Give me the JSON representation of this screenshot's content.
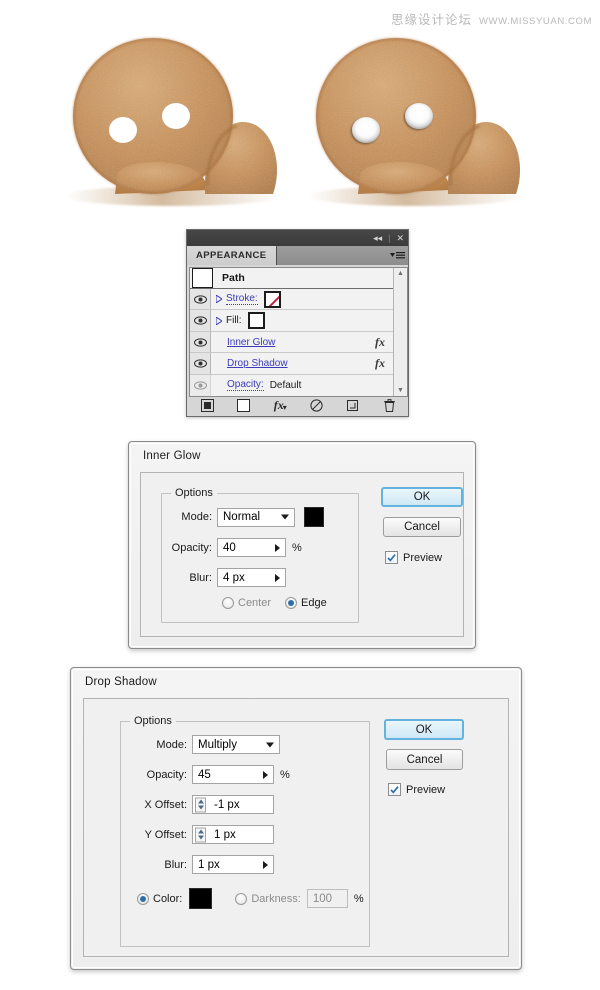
{
  "watermark": {
    "cn": "思缘设计论坛",
    "en": "WWW.MISSYUAN.COM"
  },
  "figures": [
    {
      "name": "gingerbread-before",
      "label": "gingerbread head with flat hollow eyes",
      "body_color": "#c18a52",
      "body_color_light": "#d9a873",
      "eye_fill": "#ffffff",
      "eye_style": "flat"
    },
    {
      "name": "gingerbread-after",
      "label": "gingerbread head with inner-glow and drop-shadow eyes",
      "body_color": "#c18a52",
      "body_color_light": "#d9a873",
      "eye_fill": "#ffffff",
      "eye_style": "glow"
    }
  ],
  "appearance_panel": {
    "tab_label": "APPEARANCE",
    "collapse_icon": "double-chevron-left-icon",
    "close_icon": "close-icon",
    "menu_icon": "panel-menu-icon",
    "path_row": {
      "name": "Path",
      "thumb": "white-swatch"
    },
    "rows": [
      {
        "label": "Stroke:",
        "underline": "dotted",
        "has_disclosure": true,
        "swatch": "none",
        "fx": "",
        "value": "",
        "eye": "visible"
      },
      {
        "label": "Fill:",
        "underline": "none",
        "has_disclosure": true,
        "swatch": "white",
        "fx": "",
        "value": "",
        "eye": "visible"
      },
      {
        "label": "Inner Glow",
        "underline": "solid",
        "has_disclosure": false,
        "swatch": "",
        "fx": "fx",
        "value": "",
        "eye": "visible"
      },
      {
        "label": "Drop Shadow",
        "underline": "solid",
        "has_disclosure": false,
        "swatch": "",
        "fx": "fx",
        "value": "",
        "eye": "visible"
      },
      {
        "label": "Opacity:",
        "underline": "dotted",
        "has_disclosure": false,
        "swatch": "",
        "fx": "",
        "value": "Default",
        "eye": "dim"
      }
    ],
    "scroll_up_icon": "scroll-up-arrow-icon",
    "scroll_down_icon": "scroll-down-arrow-icon",
    "footer_buttons": [
      {
        "name": "add-new-stroke-button",
        "icon": "filled-square-icon"
      },
      {
        "name": "add-new-fill-button",
        "icon": "empty-square-icon"
      },
      {
        "name": "add-new-effect-button",
        "icon": "fx-icon"
      },
      {
        "name": "clear-appearance-button",
        "icon": "no-entry-icon"
      },
      {
        "name": "duplicate-item-button",
        "icon": "duplicate-icon"
      },
      {
        "name": "delete-item-button",
        "icon": "trash-icon"
      }
    ]
  },
  "inner_glow_dialog": {
    "title": "Inner Glow",
    "options_legend": "Options",
    "mode_label": "Mode:",
    "mode_value": "Normal",
    "color_swatch": "#000000",
    "opacity_label": "Opacity:",
    "opacity_value": "40",
    "opacity_unit": "%",
    "blur_label": "Blur:",
    "blur_value": "4 px",
    "center_label": "Center",
    "edge_label": "Edge",
    "selected_origin": "Edge",
    "ok_label": "OK",
    "cancel_label": "Cancel",
    "preview_label": "Preview",
    "preview_checked": true
  },
  "drop_shadow_dialog": {
    "title": "Drop Shadow",
    "options_legend": "Options",
    "mode_label": "Mode:",
    "mode_value": "Multiply",
    "opacity_label": "Opacity:",
    "opacity_value": "45",
    "opacity_unit": "%",
    "x_offset_label": "X Offset:",
    "x_offset_value": "-1 px",
    "y_offset_label": "Y Offset:",
    "y_offset_value": "1 px",
    "blur_label": "Blur:",
    "blur_value": "1 px",
    "color_label": "Color:",
    "color_swatch": "#000000",
    "darkness_label": "Darkness:",
    "darkness_value": "100",
    "darkness_unit": "%",
    "selected_tint": "Color",
    "ok_label": "OK",
    "cancel_label": "Cancel",
    "preview_label": "Preview",
    "preview_checked": true
  }
}
